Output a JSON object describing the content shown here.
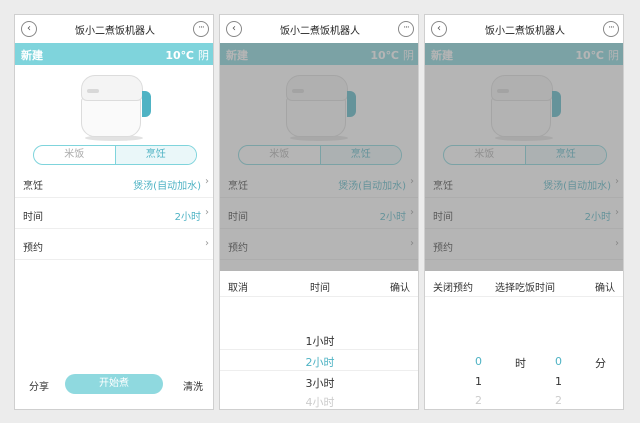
{
  "app": {
    "title": "饭小二煮饭机器人",
    "back_icon": "‹",
    "more_icon": "···",
    "device_name": "新建",
    "temperature": "10℃",
    "weather": "阴",
    "accent_color": "#7fd4dc"
  },
  "mode_tabs": [
    "米饭",
    "烹饪"
  ],
  "active_mode": "烹饪",
  "settings": {
    "cooking_label": "烹饪",
    "cooking_value": "煲汤(自动加水)",
    "time_label": "时间",
    "time_value": "2小时",
    "reserve_label": "预约",
    "chevron": "›"
  },
  "bottom": {
    "share": "分享",
    "start": "开始煮",
    "clean": "清洗"
  },
  "time_picker": {
    "cancel": "取消",
    "title": "时间",
    "confirm": "确认",
    "options": [
      "1小时",
      "2小时",
      "3小时",
      "4小时"
    ],
    "selected": "2小时"
  },
  "reserve_picker": {
    "close": "关闭预约",
    "title": "选择吃饭时间",
    "confirm": "确认",
    "hour_unit": "时",
    "minute_unit": "分",
    "hours": [
      "0",
      "1",
      "2"
    ],
    "minutes": [
      "0",
      "1",
      "2"
    ]
  }
}
